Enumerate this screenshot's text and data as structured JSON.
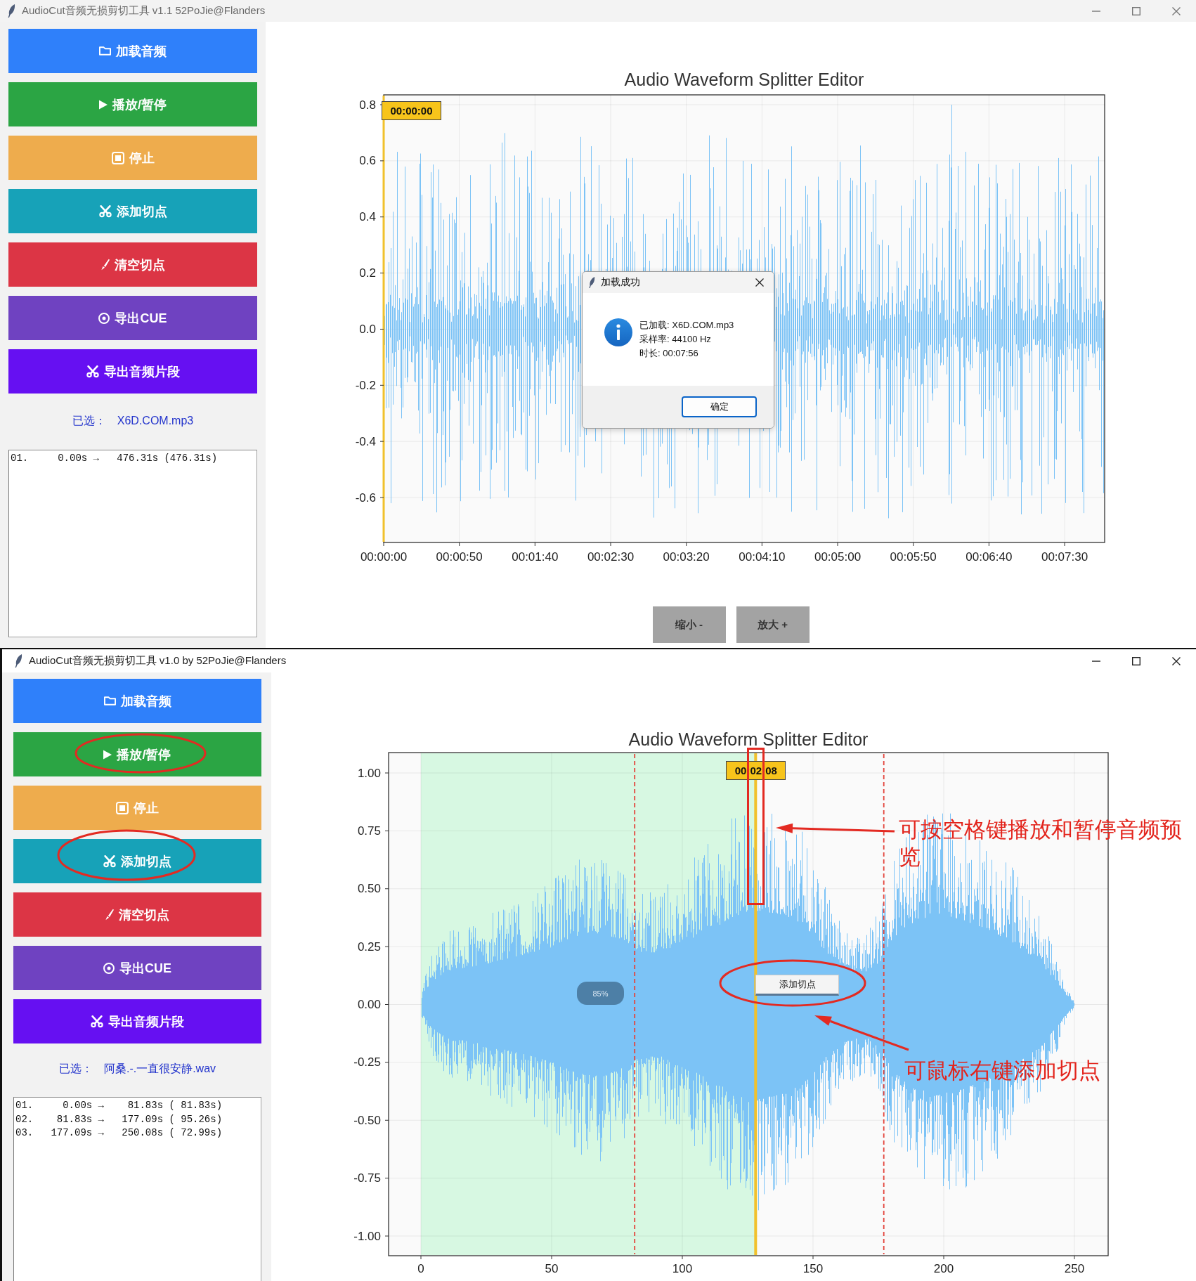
{
  "windows": [
    {
      "title": "AudioCut音频无损剪切工具 v1.1 52PoJie@Flanders",
      "sidebar": {
        "buttons": [
          {
            "kind": "load",
            "label": "加载音频",
            "color": "#2f80fa"
          },
          {
            "kind": "play",
            "label": "播放/暂停",
            "color": "#2ba544"
          },
          {
            "kind": "stop",
            "label": "停止",
            "color": "#eeac4d"
          },
          {
            "kind": "add_cut",
            "label": "添加切点",
            "color": "#17a2b8"
          },
          {
            "kind": "clear",
            "label": "清空切点",
            "color": "#dc3545"
          },
          {
            "kind": "export_cue",
            "label": "导出CUE",
            "color": "#6f42c1"
          },
          {
            "kind": "export_clips",
            "label": "导出音频片段",
            "color": "#6610f2"
          }
        ],
        "selected": {
          "label": "已选：",
          "file": "X6D.COM.mp3"
        },
        "segments": [
          "01.     0.00s →   476.31s (476.31s)"
        ]
      },
      "chart": {
        "title": "Audio Waveform Splitter Editor",
        "y_ticks": [
          "0.8",
          "0.6",
          "0.4",
          "0.2",
          "0.0",
          "-0.2",
          "-0.4",
          "-0.6"
        ],
        "x_ticks": [
          "00:00:00",
          "00:00:50",
          "00:01:40",
          "00:02:30",
          "00:03:20",
          "00:04:10",
          "00:05:00",
          "00:05:50",
          "00:06:40",
          "00:07:30"
        ],
        "playhead": {
          "time": "00:00:00",
          "level": 0
        }
      },
      "zoom_buttons": [
        "缩小 -",
        "放大 +"
      ],
      "dialog": {
        "title": "加载成功",
        "lines": [
          "已加载: X6D.COM.mp3",
          "采样率: 44100 Hz",
          "时长: 00:07:56"
        ],
        "button": "确定"
      }
    },
    {
      "title": "AudioCut音频无损剪切工具 v1.0 by 52PoJie@Flanders",
      "sidebar": {
        "buttons": [
          {
            "kind": "load",
            "label": "加载音频",
            "color": "#2f80fa"
          },
          {
            "kind": "play",
            "label": "播放/暂停",
            "color": "#2ba544"
          },
          {
            "kind": "stop",
            "label": "停止",
            "color": "#eeac4d"
          },
          {
            "kind": "add_cut",
            "label": "添加切点",
            "color": "#17a2b8"
          },
          {
            "kind": "clear",
            "label": "清空切点",
            "color": "#dc3545"
          },
          {
            "kind": "export_cue",
            "label": "导出CUE",
            "color": "#6f42c1"
          },
          {
            "kind": "export_clips",
            "label": "导出音频片段",
            "color": "#6610f2"
          }
        ],
        "selected": {
          "label": "已选：",
          "file": "阿桑.-.一直很安静.wav"
        },
        "segments": [
          "01.     0.00s →    81.83s ( 81.83s)",
          "02.    81.83s →   177.09s ( 95.26s)",
          "03.   177.09s →   250.08s ( 72.99s)"
        ]
      },
      "chart": {
        "title": "Audio Waveform Splitter Editor",
        "y_ticks": [
          "1.00",
          "0.75",
          "0.50",
          "0.25",
          "0.00",
          "-0.25",
          "-0.50",
          "-0.75",
          "-1.00"
        ],
        "x_ticks": [
          "0",
          "50",
          "100",
          "150",
          "200",
          "250"
        ],
        "playhead": {
          "time": "00:02:08",
          "level": 0.512
        },
        "cut_markers": [
          {
            "level": 0.327
          },
          {
            "level": 0.708
          }
        ],
        "badge": "85%",
        "context_menu": [
          "添加切点"
        ]
      },
      "annotations": [
        "可按空格键播放和暂停音频预览",
        "可鼠标右键添加切点"
      ]
    }
  ]
}
